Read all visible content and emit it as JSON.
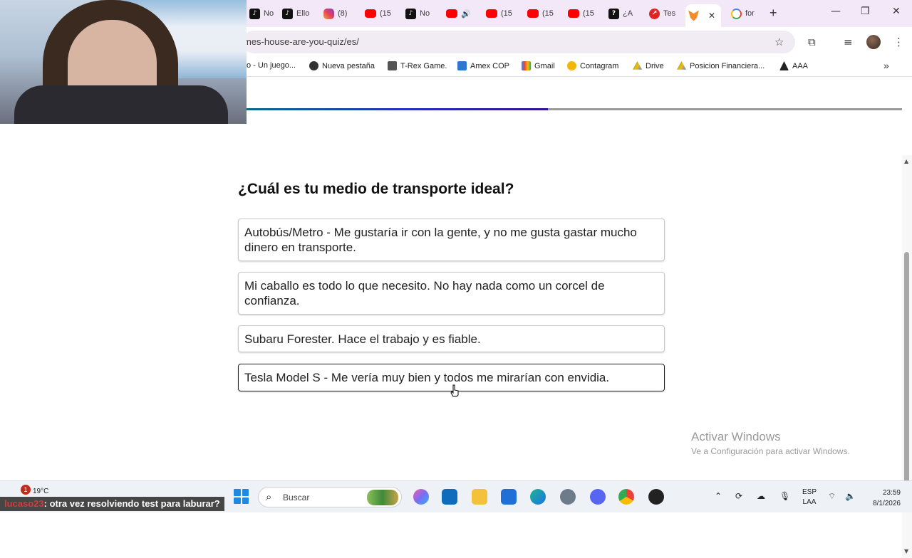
{
  "browser": {
    "tabs": [
      {
        "icon": "tiktok-icon",
        "label": "No"
      },
      {
        "icon": "tiktok-icon",
        "label": "Ello"
      },
      {
        "icon": "instagram-icon",
        "label": "(8)"
      },
      {
        "icon": "youtube-icon",
        "label": "(15"
      },
      {
        "icon": "tiktok-icon",
        "label": "No"
      },
      {
        "icon": "youtube-icon",
        "label": ""
      },
      {
        "icon": "youtube-icon",
        "label": "(15"
      },
      {
        "icon": "youtube-icon",
        "label": "(15"
      },
      {
        "icon": "youtube-icon",
        "label": "(15"
      },
      {
        "icon": "question-site-icon",
        "label": "¿A"
      },
      {
        "icon": "red-chart-icon",
        "label": "Tes"
      },
      {
        "icon": "fox-icon",
        "label": ""
      },
      {
        "icon": "google-icon",
        "label": "for"
      }
    ],
    "tab_close_glyph": "✕",
    "new_tab_glyph": "+",
    "window_controls": {
      "minimize": "—",
      "restore": "❐",
      "close": "✕"
    },
    "url": "mes-house-are-you-quiz/es/",
    "toolbar_icons": {
      "star": "☆",
      "extensions": "⧉",
      "media": "≡",
      "menu": "⋮"
    },
    "bookmarks": [
      {
        "label": "o - Un juego...",
        "icon": "game-icon"
      },
      {
        "label": "Nueva pestaña",
        "icon": "chrome-icon"
      },
      {
        "label": "T-Rex Game.",
        "icon": "dino-icon"
      },
      {
        "label": "Amex COP",
        "icon": "amex-icon"
      },
      {
        "label": "Gmail",
        "icon": "gmail-icon"
      },
      {
        "label": "Contagram",
        "icon": "contagram-icon"
      },
      {
        "label": "Drive",
        "icon": "drive-icon"
      },
      {
        "label": "Posicion Financiera...",
        "icon": "drive-icon"
      },
      {
        "label": "AAA",
        "icon": "aaa-icon"
      }
    ],
    "bookmarks_more": "»"
  },
  "quiz": {
    "progress_percent": 46,
    "question": "¿Cuál es tu medio de transporte ideal?",
    "options": [
      "Autobús/Metro - Me gustaría ir con la gente, y no me gusta gastar mucho dinero en transporte.",
      "Mi caballo es todo lo que necesito. No hay nada como un corcel de confianza.",
      "Subaru Forester. Hace el trabajo y es fiable.",
      "Tesla Model S - Me vería muy bien y todos me mirarían con envidia."
    ],
    "hovered_option_index": 3
  },
  "watermark": {
    "title": "Activar Windows",
    "subtitle": "Ve a Configuración para activar Windows."
  },
  "taskbar": {
    "weather_temp": "19°C",
    "notification_count": "1",
    "caption_user": "lucaso23",
    "caption_text": ": otra vez resolviendo test para laburar?",
    "search_placeholder": "Buscar",
    "language_line1": "ESP",
    "language_line2": "LAA",
    "time": "23:59",
    "date": "8/1/2026"
  }
}
